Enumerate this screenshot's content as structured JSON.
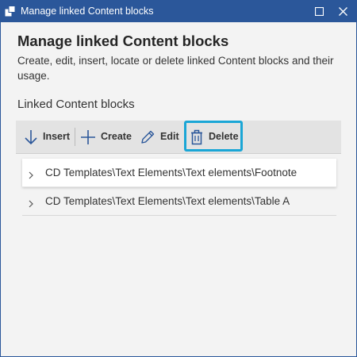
{
  "window": {
    "title": "Manage linked Content blocks",
    "icon": "app-icon",
    "controls": [
      "maximize-icon",
      "close-icon"
    ]
  },
  "main": {
    "heading": "Manage linked Content blocks",
    "description": "Create, edit, insert, locate or delete linked Content blocks and their usage.",
    "section_label": "Linked Content blocks"
  },
  "toolbar": {
    "insert": {
      "label": "Insert",
      "icon": "arrow-down-icon"
    },
    "create": {
      "label": "Create",
      "icon": "plus-icon"
    },
    "edit": {
      "label": "Edit",
      "icon": "pencil-icon"
    },
    "delete": {
      "label": "Delete",
      "icon": "trash-icon",
      "highlighted": true
    }
  },
  "list": {
    "items": [
      {
        "path": "CD Templates\\Text Elements\\Text elements\\Footnote",
        "selected": true
      },
      {
        "path": "CD Templates\\Text Elements\\Text elements\\Table A",
        "selected": false
      }
    ]
  },
  "colors": {
    "titlebar": "#2b579a",
    "highlight": "#1aa6d6",
    "background": "#f3f3f3",
    "toolbar": "#e3e3e3"
  }
}
